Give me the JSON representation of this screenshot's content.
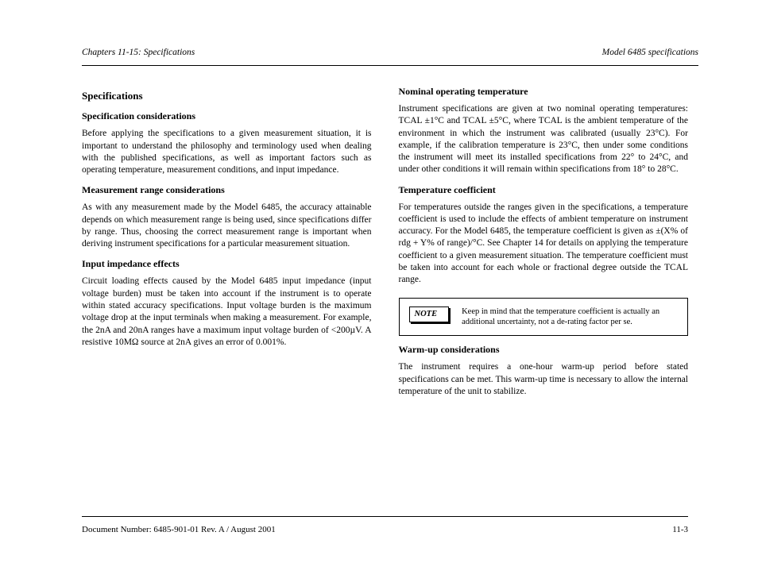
{
  "header": {
    "left": "Chapters 11-15: Specifications",
    "right": "Model 6485 specifications"
  },
  "left_col": {
    "h1": "Specifications",
    "h2": "Specification considerations",
    "p1": "Before applying the specifications to a given measurement situation, it is important to understand the philosophy and terminology used when dealing with the published specifications, as well as important factors such as operating temperature, measurement conditions, and input impedance.",
    "h3": "Measurement range considerations",
    "p2": "As with any measurement made by the Model 6485, the accuracy attainable depends on which measurement range is being used, since specifications differ by range. Thus, choosing the correct measurement range is important when deriving instrument specifications for a particular measurement situation.",
    "h3b": "Input impedance effects",
    "p3": "Circuit loading effects caused by the Model 6485 input impedance (input voltage burden) must be taken into account if the instrument is to operate within stated accuracy specifications. Input voltage burden is the maximum voltage drop at the input terminals when making a measurement. For example, the 2nA and 20nA ranges have a maximum input voltage burden of <200µV. A resistive 10MΩ source at 2nA gives an error of 0.001%."
  },
  "right_col": {
    "h3": "Nominal operating temperature",
    "p1": "Instrument specifications are given at two nominal operating temperatures: TCAL ±1°C and TCAL ±5°C, where TCAL is the ambient temperature of the environment in which the instrument was calibrated (usually 23°C). For example, if the calibration temperature is 23°C, then under some conditions the instrument will meet its installed specifications from 22° to 24°C, and under other conditions it will remain within specifications from 18° to 28°C.",
    "h3b": "Temperature coefficient",
    "p2": "For temperatures outside the ranges given in the specifications, a temperature coefficient is used to include the effects of ambient temperature on instrument accuracy. For the Model 6485, the temperature coefficient is given as ±(X% of rdg + Y% of range)/°C. See Chapter 14 for details on applying the temperature coefficient to a given measurement situation. The temperature coefficient must be taken into account for each whole or fractional degree outside the TCAL range.",
    "note_label": "NOTE",
    "note_text": "Keep in mind that the temperature coefficient is actually an additional uncertainty, not a de-rating factor per se.",
    "h3c": "Warm-up considerations",
    "p3": "The instrument requires a one-hour warm-up period before stated specifications can be met. This warm-up time is necessary to allow the internal temperature of the unit to stabilize."
  },
  "footer": {
    "left": "Document Number: 6485-901-01 Rev. A / August 2001",
    "right": "11-3"
  }
}
